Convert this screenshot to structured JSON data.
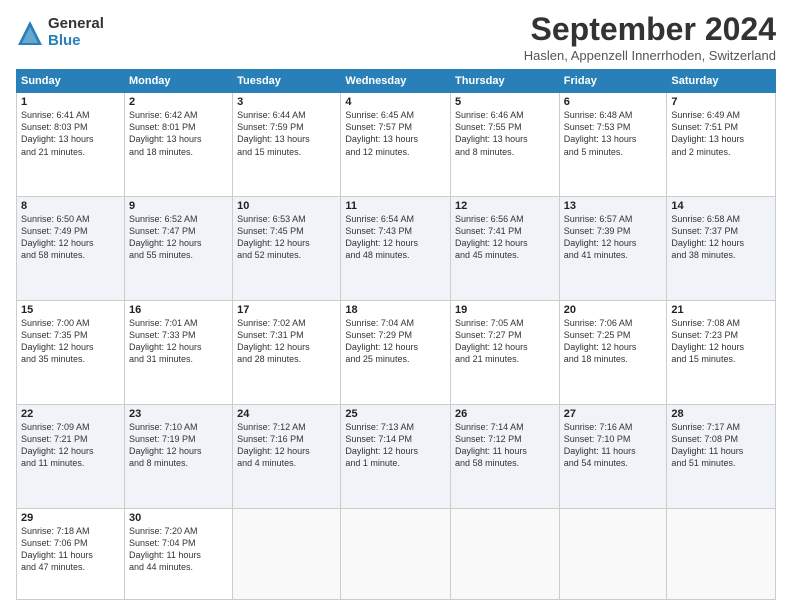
{
  "header": {
    "logo_general": "General",
    "logo_blue": "Blue",
    "month_title": "September 2024",
    "location": "Haslen, Appenzell Innerrhoden, Switzerland"
  },
  "weekdays": [
    "Sunday",
    "Monday",
    "Tuesday",
    "Wednesday",
    "Thursday",
    "Friday",
    "Saturday"
  ],
  "weeks": [
    [
      {
        "day": "1",
        "info": "Sunrise: 6:41 AM\nSunset: 8:03 PM\nDaylight: 13 hours\nand 21 minutes."
      },
      {
        "day": "2",
        "info": "Sunrise: 6:42 AM\nSunset: 8:01 PM\nDaylight: 13 hours\nand 18 minutes."
      },
      {
        "day": "3",
        "info": "Sunrise: 6:44 AM\nSunset: 7:59 PM\nDaylight: 13 hours\nand 15 minutes."
      },
      {
        "day": "4",
        "info": "Sunrise: 6:45 AM\nSunset: 7:57 PM\nDaylight: 13 hours\nand 12 minutes."
      },
      {
        "day": "5",
        "info": "Sunrise: 6:46 AM\nSunset: 7:55 PM\nDaylight: 13 hours\nand 8 minutes."
      },
      {
        "day": "6",
        "info": "Sunrise: 6:48 AM\nSunset: 7:53 PM\nDaylight: 13 hours\nand 5 minutes."
      },
      {
        "day": "7",
        "info": "Sunrise: 6:49 AM\nSunset: 7:51 PM\nDaylight: 13 hours\nand 2 minutes."
      }
    ],
    [
      {
        "day": "8",
        "info": "Sunrise: 6:50 AM\nSunset: 7:49 PM\nDaylight: 12 hours\nand 58 minutes."
      },
      {
        "day": "9",
        "info": "Sunrise: 6:52 AM\nSunset: 7:47 PM\nDaylight: 12 hours\nand 55 minutes."
      },
      {
        "day": "10",
        "info": "Sunrise: 6:53 AM\nSunset: 7:45 PM\nDaylight: 12 hours\nand 52 minutes."
      },
      {
        "day": "11",
        "info": "Sunrise: 6:54 AM\nSunset: 7:43 PM\nDaylight: 12 hours\nand 48 minutes."
      },
      {
        "day": "12",
        "info": "Sunrise: 6:56 AM\nSunset: 7:41 PM\nDaylight: 12 hours\nand 45 minutes."
      },
      {
        "day": "13",
        "info": "Sunrise: 6:57 AM\nSunset: 7:39 PM\nDaylight: 12 hours\nand 41 minutes."
      },
      {
        "day": "14",
        "info": "Sunrise: 6:58 AM\nSunset: 7:37 PM\nDaylight: 12 hours\nand 38 minutes."
      }
    ],
    [
      {
        "day": "15",
        "info": "Sunrise: 7:00 AM\nSunset: 7:35 PM\nDaylight: 12 hours\nand 35 minutes."
      },
      {
        "day": "16",
        "info": "Sunrise: 7:01 AM\nSunset: 7:33 PM\nDaylight: 12 hours\nand 31 minutes."
      },
      {
        "day": "17",
        "info": "Sunrise: 7:02 AM\nSunset: 7:31 PM\nDaylight: 12 hours\nand 28 minutes."
      },
      {
        "day": "18",
        "info": "Sunrise: 7:04 AM\nSunset: 7:29 PM\nDaylight: 12 hours\nand 25 minutes."
      },
      {
        "day": "19",
        "info": "Sunrise: 7:05 AM\nSunset: 7:27 PM\nDaylight: 12 hours\nand 21 minutes."
      },
      {
        "day": "20",
        "info": "Sunrise: 7:06 AM\nSunset: 7:25 PM\nDaylight: 12 hours\nand 18 minutes."
      },
      {
        "day": "21",
        "info": "Sunrise: 7:08 AM\nSunset: 7:23 PM\nDaylight: 12 hours\nand 15 minutes."
      }
    ],
    [
      {
        "day": "22",
        "info": "Sunrise: 7:09 AM\nSunset: 7:21 PM\nDaylight: 12 hours\nand 11 minutes."
      },
      {
        "day": "23",
        "info": "Sunrise: 7:10 AM\nSunset: 7:19 PM\nDaylight: 12 hours\nand 8 minutes."
      },
      {
        "day": "24",
        "info": "Sunrise: 7:12 AM\nSunset: 7:16 PM\nDaylight: 12 hours\nand 4 minutes."
      },
      {
        "day": "25",
        "info": "Sunrise: 7:13 AM\nSunset: 7:14 PM\nDaylight: 12 hours\nand 1 minute."
      },
      {
        "day": "26",
        "info": "Sunrise: 7:14 AM\nSunset: 7:12 PM\nDaylight: 11 hours\nand 58 minutes."
      },
      {
        "day": "27",
        "info": "Sunrise: 7:16 AM\nSunset: 7:10 PM\nDaylight: 11 hours\nand 54 minutes."
      },
      {
        "day": "28",
        "info": "Sunrise: 7:17 AM\nSunset: 7:08 PM\nDaylight: 11 hours\nand 51 minutes."
      }
    ],
    [
      {
        "day": "29",
        "info": "Sunrise: 7:18 AM\nSunset: 7:06 PM\nDaylight: 11 hours\nand 47 minutes."
      },
      {
        "day": "30",
        "info": "Sunrise: 7:20 AM\nSunset: 7:04 PM\nDaylight: 11 hours\nand 44 minutes."
      },
      {
        "day": "",
        "info": ""
      },
      {
        "day": "",
        "info": ""
      },
      {
        "day": "",
        "info": ""
      },
      {
        "day": "",
        "info": ""
      },
      {
        "day": "",
        "info": ""
      }
    ]
  ]
}
